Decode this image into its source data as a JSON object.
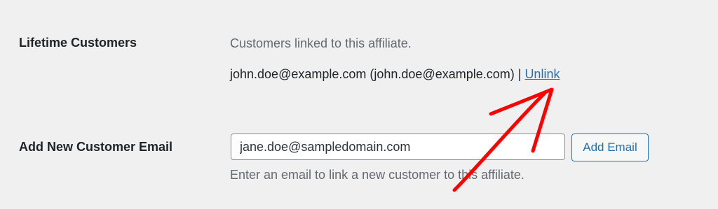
{
  "lifetime_customers": {
    "label": "Lifetime Customers",
    "description": "Customers linked to this affiliate.",
    "customer_entry": "john.doe@example.com (john.doe@example.com)",
    "separator": " | ",
    "unlink_label": "Unlink"
  },
  "add_customer": {
    "label": "Add New Customer Email",
    "input_value": "jane.doe@sampledomain.com",
    "button_label": "Add Email",
    "help_text": "Enter an email to link a new customer to this affiliate."
  },
  "colors": {
    "background": "#f0f0f1",
    "link": "#2271b1",
    "annotation_arrow": "#ff0000"
  }
}
